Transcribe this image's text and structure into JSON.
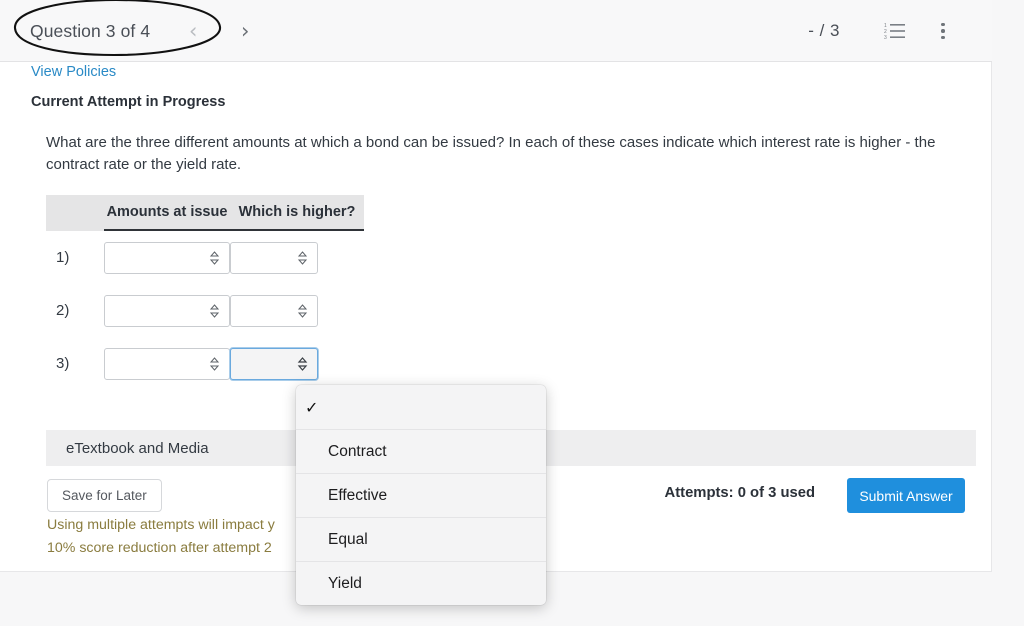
{
  "toolbar": {
    "question_counter": "Question 3 of 4",
    "prev_label": "‹",
    "next_label": "›",
    "score": "- / 3",
    "list_icon": "numbered-list-icon",
    "menu_icon": "kebab-menu-icon"
  },
  "content": {
    "policies_link": "View Policies",
    "attempt_status": "Current Attempt in Progress",
    "question_text": "What are the three different amounts at which a bond can be issued? In each of these cases indicate which interest rate is higher - the contract rate or the yield rate."
  },
  "table": {
    "headers": {
      "spacer": "",
      "col1": "Amounts at issue",
      "col2": "Which is higher?"
    },
    "rows": [
      {
        "num": "1)",
        "amount_value": "",
        "higher_value": ""
      },
      {
        "num": "2)",
        "amount_value": "",
        "higher_value": ""
      },
      {
        "num": "3)",
        "amount_value": "",
        "higher_value": ""
      }
    ]
  },
  "etextbook": {
    "label": "eTextbook and Media"
  },
  "footer": {
    "save_for_later": "Save for Later",
    "warning_line1": "Using multiple attempts will impact y",
    "warning_line2": "10% score reduction after attempt 2",
    "attempts": "Attempts: 0 of 3 used",
    "submit_label": "Submit Answer"
  },
  "dropdown": {
    "items": [
      {
        "label": "",
        "checked": "✓"
      },
      {
        "label": "Contract",
        "checked": ""
      },
      {
        "label": "Effective",
        "checked": ""
      },
      {
        "label": "Equal",
        "checked": ""
      },
      {
        "label": "Yield",
        "checked": ""
      }
    ]
  },
  "annotation": {
    "shape": "hand-drawn-ellipse",
    "target": "Question 3 of 4"
  },
  "colors": {
    "accent_blue": "#1f8fdd",
    "link_blue": "#2a8ac6",
    "warning_olive": "#8a7c3f",
    "header_gray": "#e5e5e6"
  }
}
